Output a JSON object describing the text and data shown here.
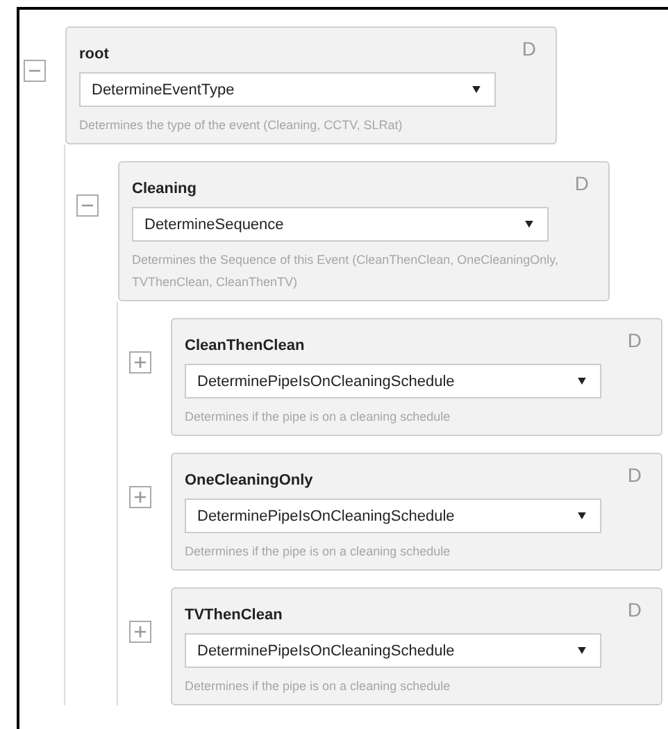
{
  "tree": {
    "title": "root",
    "flag": "D",
    "rule": "DetermineEventType",
    "description": "Determines the type of the event (Cleaning, CCTV, SLRat)",
    "expanded": true,
    "children": [
      {
        "title": "Cleaning",
        "flag": "D",
        "rule": "DetermineSequence",
        "description": "Determines the Sequence of this Event (CleanThenClean, OneCleaningOnly, TVThenClean, CleanThenTV)",
        "expanded": true,
        "children": [
          {
            "title": "CleanThenClean",
            "flag": "D",
            "rule": "DeterminePipeIsOnCleaningSchedule",
            "description": "Determines if the pipe is on a cleaning schedule",
            "expanded": false
          },
          {
            "title": "OneCleaningOnly",
            "flag": "D",
            "rule": "DeterminePipeIsOnCleaningSchedule",
            "description": "Determines if the pipe is on a cleaning schedule",
            "expanded": false
          },
          {
            "title": "TVThenClean",
            "flag": "D",
            "rule": "DeterminePipeIsOnCleaningSchedule",
            "description": "Determines if the pipe is on a cleaning schedule",
            "expanded": false
          }
        ]
      }
    ]
  }
}
